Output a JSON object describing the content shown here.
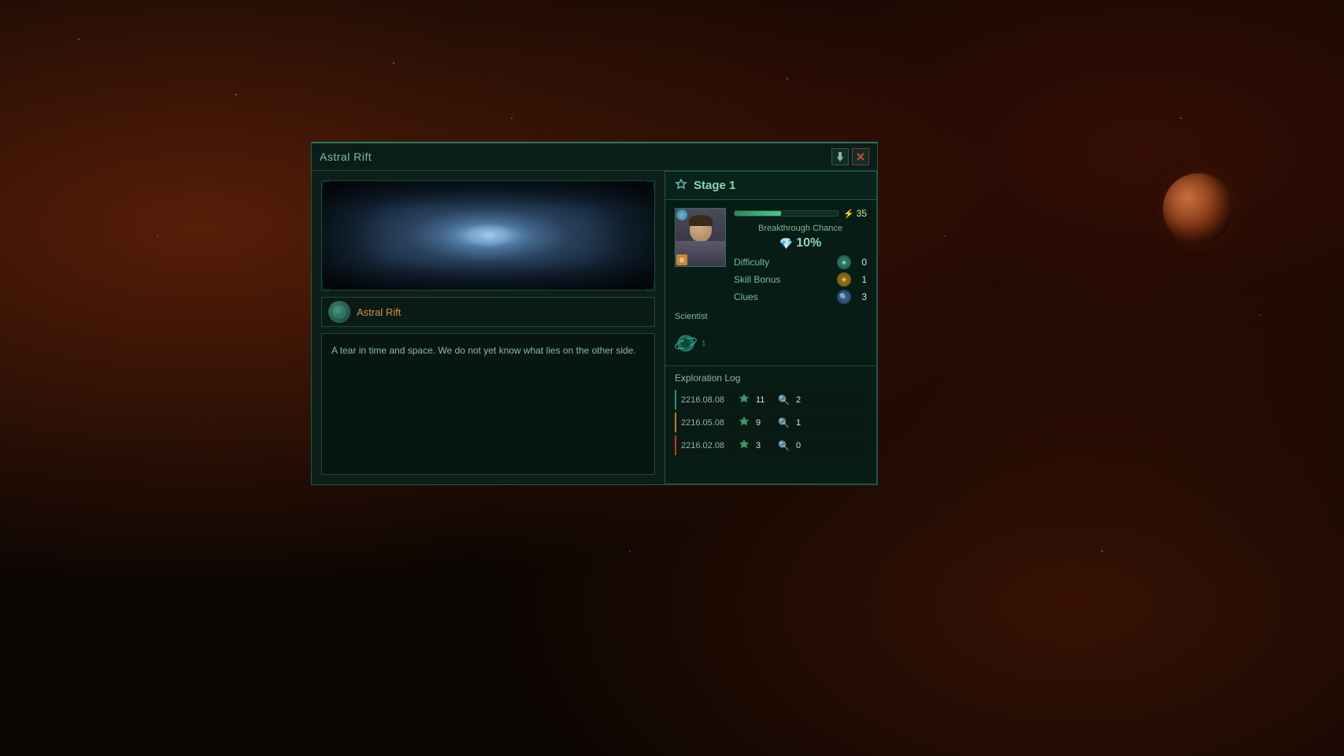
{
  "app": {
    "title": "Astral Rift",
    "background": {
      "desc": "space nebula background"
    }
  },
  "dialog": {
    "title": "Astral Rift",
    "pin_btn": "📌",
    "close_btn": "✕",
    "location_name": "Astral Rift",
    "description": "A tear in time and space. We do not yet know what lies on the other side.",
    "image_alt": "Astral Rift nebula image"
  },
  "stage": {
    "title": "Stage 1",
    "progress": 45,
    "progress_max": 100,
    "energy_value": 35,
    "breakthrough_label": "Breakthrough Chance",
    "breakthrough_value": "10%",
    "scientist_label": "Scientist",
    "stats": {
      "difficulty_label": "Difficulty",
      "difficulty_value": "0",
      "skill_bonus_label": "Skill Bonus",
      "skill_bonus_value": "1",
      "clues_label": "Clues",
      "clues_value": "3"
    }
  },
  "exploration_log": {
    "title": "Exploration Log",
    "entries": [
      {
        "date": "2216.08.08",
        "artifact_value": 11,
        "clues_value": 2,
        "border_color": "teal"
      },
      {
        "date": "2216.05.08",
        "artifact_value": 9,
        "clues_value": 1,
        "border_color": "orange"
      },
      {
        "date": "2216.02.08",
        "artifact_value": 3,
        "clues_value": 0,
        "border_color": "red"
      }
    ]
  },
  "planet": {
    "desc": "Mars-like planet"
  }
}
